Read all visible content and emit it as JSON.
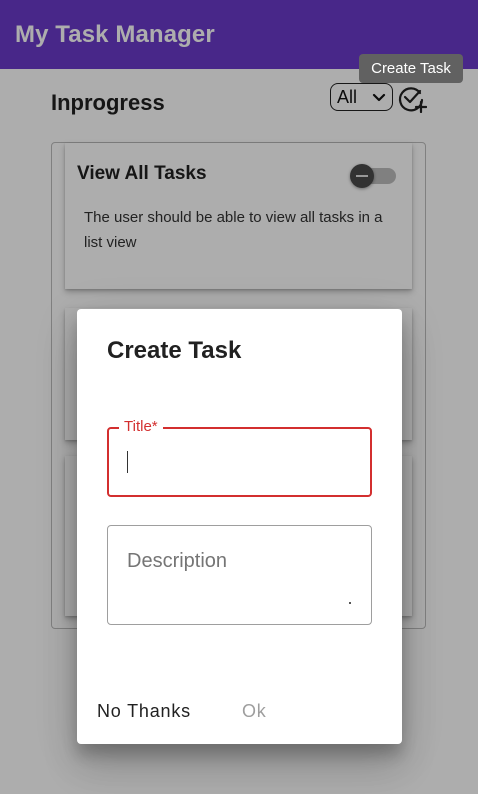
{
  "app": {
    "title": "My Task Manager",
    "bar_color": "#6a3acb"
  },
  "toolbar": {
    "section_title": "Inprogress",
    "filter": {
      "selected": "All"
    },
    "create_icon": "add-task-icon",
    "tooltip": "Create Task"
  },
  "tasks": [
    {
      "title": "View All Tasks",
      "description": "The user should be able to view all tasks in a list view",
      "completed": false
    }
  ],
  "dialog": {
    "title": "Create Task",
    "title_field": {
      "label": "Title*",
      "value": ""
    },
    "description_field": {
      "placeholder": "Description",
      "value": ""
    },
    "cancel_label": "No Thanks",
    "ok_label": "Ok",
    "error_color": "#d32f2f"
  }
}
